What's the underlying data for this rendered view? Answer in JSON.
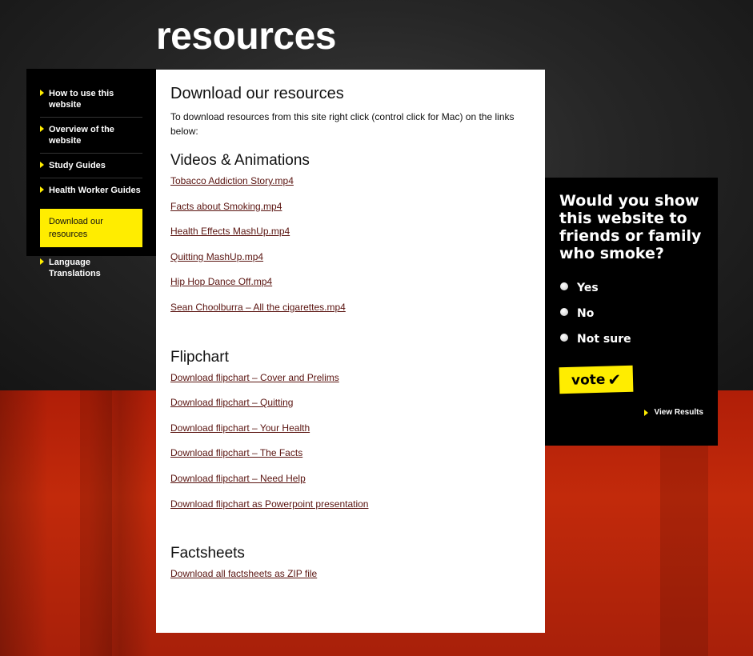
{
  "page": {
    "title": "resources"
  },
  "sidebar": {
    "items": [
      {
        "label": "How to use this website",
        "active": false
      },
      {
        "label": "Overview of the website",
        "active": false
      },
      {
        "label": "Study Guides",
        "active": false
      },
      {
        "label": "Health Worker Guides",
        "active": false
      },
      {
        "label": "Download our resources",
        "active": true
      },
      {
        "label": "Language Translations",
        "active": false
      }
    ]
  },
  "main": {
    "heading": "Download our resources",
    "intro": "To download resources from this site right click (control click for Mac) on the links below:",
    "sections": [
      {
        "title": "Videos & Animations",
        "links": [
          "Tobacco Addiction Story.mp4",
          "Facts about Smoking.mp4",
          "Health Effects MashUp.mp4",
          "Quitting MashUp.mp4",
          "Hip Hop Dance Off.mp4",
          "Sean Choolburra – All the cigarettes.mp4"
        ]
      },
      {
        "title": "Flipchart",
        "links": [
          "Download flipchart – Cover and Prelims",
          "Download flipchart – Quitting",
          "Download flipchart – Your Health",
          "Download flipchart – The Facts",
          "Download flipchart – Need Help",
          "Download flipchart as Powerpoint presentation"
        ]
      },
      {
        "title": "Factsheets",
        "links": [
          "Download all factsheets as ZIP file"
        ]
      }
    ]
  },
  "poll": {
    "question": "Would you show this website to friends or family who smoke?",
    "options": [
      "Yes",
      "No",
      "Not sure"
    ],
    "vote_label": "vote",
    "view_results_label": "View Results"
  },
  "colors": {
    "accent_yellow": "#ffed00",
    "link": "#5a1410",
    "panel_black": "#000000",
    "flag_red": "#c22a0b"
  }
}
